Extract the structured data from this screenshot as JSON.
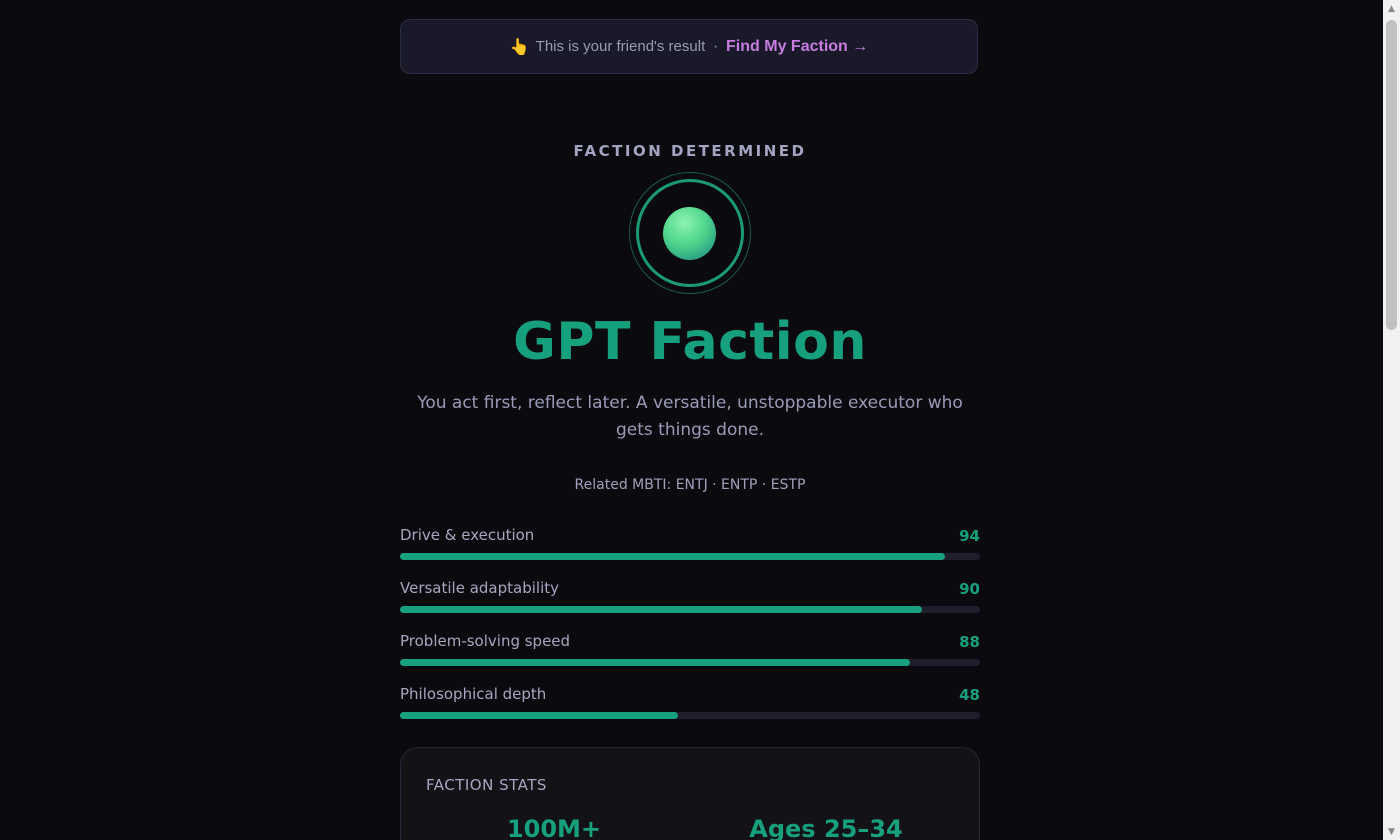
{
  "banner": {
    "hand_icon": "pointing-hand",
    "text": "This is your friend's result",
    "separator": "·",
    "cta": "Find My Faction →"
  },
  "result": {
    "eyebrow": "FACTION DETERMINED",
    "title": "GPT Faction",
    "description": "You act first, reflect later. A versatile, unstoppable executor who gets things done.",
    "mbti": "Related MBTI: ENTJ · ENTP · ESTP",
    "accent_color": "#17a07e"
  },
  "traits": [
    {
      "label": "Drive & execution",
      "value": "94",
      "level": 0.94
    },
    {
      "label": "Versatile adaptability",
      "value": "90",
      "level": 0.9
    },
    {
      "label": "Problem-solving speed",
      "value": "88",
      "level": 0.88
    },
    {
      "label": "Philosophical depth",
      "value": "48",
      "level": 0.48
    }
  ],
  "faction_stats": {
    "title": "FACTION STATS",
    "users": "100M+",
    "ages": "Ages 25–34"
  },
  "scrollbar": {
    "up_icon": "scroll-up-arrow",
    "down_icon": "scroll-down-arrow"
  }
}
